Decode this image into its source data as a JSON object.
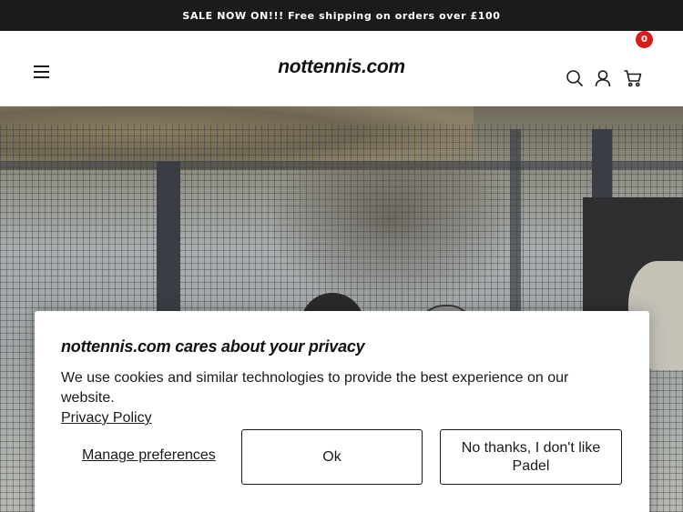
{
  "announcement": {
    "text": "SALE NOW ON!!! Free shipping on orders over £100"
  },
  "header": {
    "brand": "nottennis.com",
    "menu_icon": "hamburger-menu-icon",
    "search_icon": "search-icon",
    "account_icon": "user-icon",
    "cart_icon": "cart-icon",
    "cart_count": "0",
    "badge_color": "#d81b1b"
  },
  "cookie_banner": {
    "title": "nottennis.com cares about your privacy",
    "body": "We use cookies and similar technologies to provide the best experience on our website.",
    "privacy_link": "Privacy Policy",
    "manage_label": "Manage preferences",
    "ok_label": "Ok",
    "decline_label": "No thanks, I don't like Padel"
  }
}
